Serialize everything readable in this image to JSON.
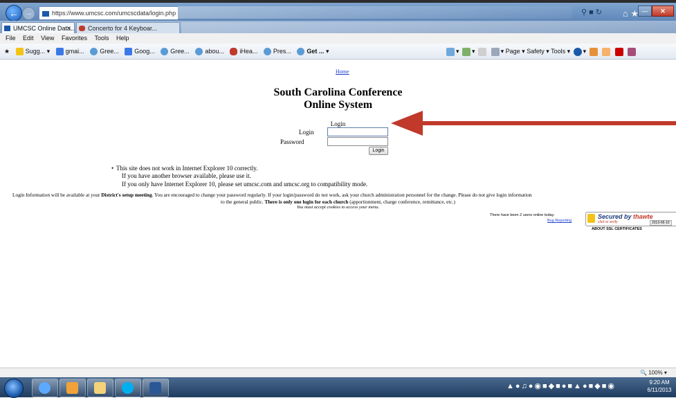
{
  "browser": {
    "address_url": "https://www.umcsc.com/umcscdata/login.php",
    "tabs": [
      {
        "label": "UMCSC Online Data..."
      },
      {
        "label": "Concerto for 4 Keyboar..."
      }
    ],
    "menu": [
      "File",
      "Edit",
      "View",
      "Favorites",
      "Tools",
      "Help"
    ],
    "favorites": [
      "Sugg...",
      "gmai...",
      "Gree...",
      "Goog...",
      "Gree...",
      "abou...",
      "iHea...",
      "Pres...",
      "Get ..."
    ],
    "commands": {
      "page": "Page",
      "safety": "Safety",
      "tools": "Tools"
    },
    "zoom": "100%",
    "colors": {
      "titlebar": "#5f87b8",
      "link": "#1a3fd1",
      "arrow": "#c0392b"
    }
  },
  "page": {
    "home_link": "Home",
    "title_line1": "South Carolina Conference",
    "title_line2": "Online System",
    "login_heading": "Login",
    "login_label": "Login",
    "password_label": "Password",
    "login_button": "Login",
    "notes": [
      "This site does not work in Internet Explorer 10 correctly.",
      "If you have another browser available, please use it.",
      "If you only have Internet Explorer 10, please set umcsc.com and umcsc.org to compatibility mode."
    ],
    "info": {
      "p1": "Login Information will be available at your ",
      "b1": "District's setup meeting",
      "p2": ".  You are encouraged to change your password regularly.  If your login/password do not work, ask your church administration personnel for the change.  Please do not give login information",
      "p3": "to the general public.  ",
      "b2": "There is only one login for each church",
      "p4": " (apportionment, charge conference, remittance, etc.)"
    },
    "cookies_note": "You must accept cookies to access your menu.",
    "users_online": "There have been 2 users online today.",
    "bug_link": "Bug Reporting",
    "ssl": {
      "secured": "Secured by",
      "brand": "thawte",
      "verify": "click to verify",
      "date": "2013-06-10",
      "about": "ABOUT SSL CERTIFICATES"
    }
  },
  "taskbar": {
    "clock_time": "9:20 AM",
    "clock_date": "6/11/2013"
  }
}
